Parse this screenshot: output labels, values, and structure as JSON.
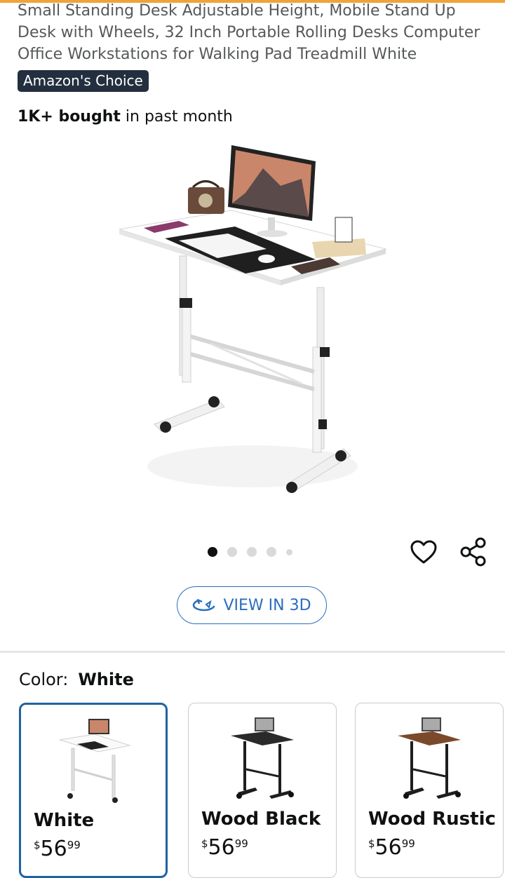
{
  "product": {
    "title": "Small Standing Desk Adjustable Height, Mobile Stand Up Desk with Wheels, 32 Inch Portable Rolling Desks Computer Office Workstations for Walking Pad Treadmill White",
    "badge": "Amazon's Choice",
    "bought_bold": "1K+ bought",
    "bought_rest": " in past month"
  },
  "gallery": {
    "image_count": 5,
    "active_index": 0
  },
  "actions": {
    "view3d_label": "VIEW IN 3D",
    "wishlist_icon": "heart-icon",
    "share_icon": "share-icon"
  },
  "variations": {
    "label": "Color:",
    "selected": "White",
    "options": [
      {
        "name": "White",
        "currency": "$",
        "whole": "56",
        "fraction": "99",
        "selected": true,
        "top_color": "#f4f4f4",
        "frame_color": "#e8e8e8"
      },
      {
        "name": "Wood Black",
        "currency": "$",
        "whole": "56",
        "fraction": "99",
        "selected": false,
        "top_color": "#2a2a2a",
        "frame_color": "#1e1e1e"
      },
      {
        "name": "Wood Rustic",
        "currency": "$",
        "whole": "56",
        "fraction": "99",
        "selected": false,
        "top_color": "#7a4a2a",
        "frame_color": "#1e1e1e"
      }
    ]
  },
  "colors": {
    "accent": "#2162a1",
    "link": "#2a6dbd",
    "badge_bg": "#232f3e"
  }
}
